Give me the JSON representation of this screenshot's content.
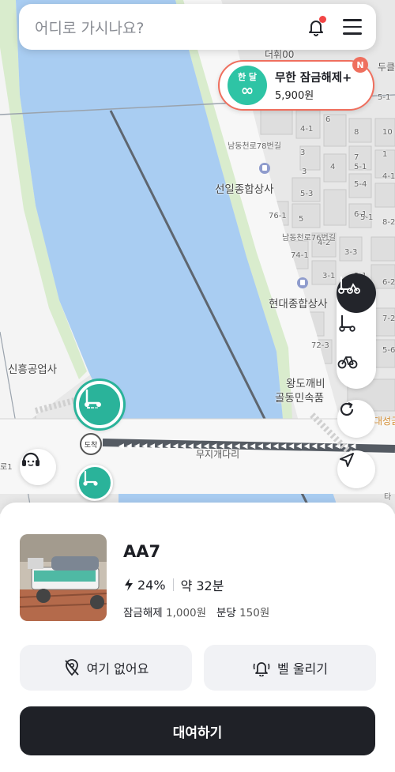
{
  "search": {
    "placeholder": "어디로 가시나요?"
  },
  "header": {
    "bell_icon": "bell-icon",
    "menu_icon": "hamburger-menu-icon",
    "notification_color": "#f24646"
  },
  "promo": {
    "badge_text": "한 달",
    "badge_symbol": "∞",
    "title": "무한 잠금해제+",
    "price": "5,900원",
    "new_badge": "N",
    "accent_color": "#ef6f5e",
    "badge_color": "#2ec4a5"
  },
  "map": {
    "labels": {
      "top_building": "더휘00",
      "top_right": "두클",
      "road_78": "남동천로78번길",
      "seonil": "선일종합상사",
      "road_76": "남동천로76번길",
      "hyundai": "현대종합상사",
      "shinheung": "신흥공업사",
      "wangdokkaebi_1": "왕도깨비",
      "wangdokkaebi_2": "골동민속품",
      "daesung": "대성금",
      "mujigae": "무지개다리",
      "arrive": "도착",
      "left_edge": "로1",
      "bottom_right": "타"
    },
    "block_numbers": [
      "5-1",
      "6",
      "4-1",
      "4",
      "3",
      "5-3",
      "5-4",
      "7",
      "8",
      "10",
      "4-10",
      "8-2",
      "6-1",
      "76-1",
      "74-1",
      "4-2",
      "3-3",
      "3-1",
      "2-1",
      "5-1",
      "6-2",
      "5",
      "7-2",
      "72-3",
      "5-6",
      "5-1",
      "1",
      "3"
    ]
  },
  "controls": {
    "filter_all_icon": "scooter-and-bike-icon",
    "filter_scooter_icon": "scooter-icon",
    "filter_bike_icon": "bicycle-icon",
    "refresh_icon": "refresh-icon",
    "locate_icon": "location-arrow-icon",
    "support_icon": "headset-support-icon"
  },
  "vehicle": {
    "id": "AA7",
    "battery": "24%",
    "battery_icon": "lightning-icon",
    "range": "약 32분",
    "unlock_label": "잠금해제",
    "unlock_price": "1,000원",
    "per_min_label": "분당",
    "per_min_price": "150원"
  },
  "actions": {
    "not_here": "여기 없어요",
    "not_here_icon": "location-off-icon",
    "ring_bell": "벨 울리기",
    "ring_bell_icon": "bell-ring-icon",
    "rent": "대여하기"
  },
  "colors": {
    "brand": "#2ab39a",
    "dark": "#1f2127",
    "water": "#a9cdf2",
    "park": "#d9eccd"
  }
}
